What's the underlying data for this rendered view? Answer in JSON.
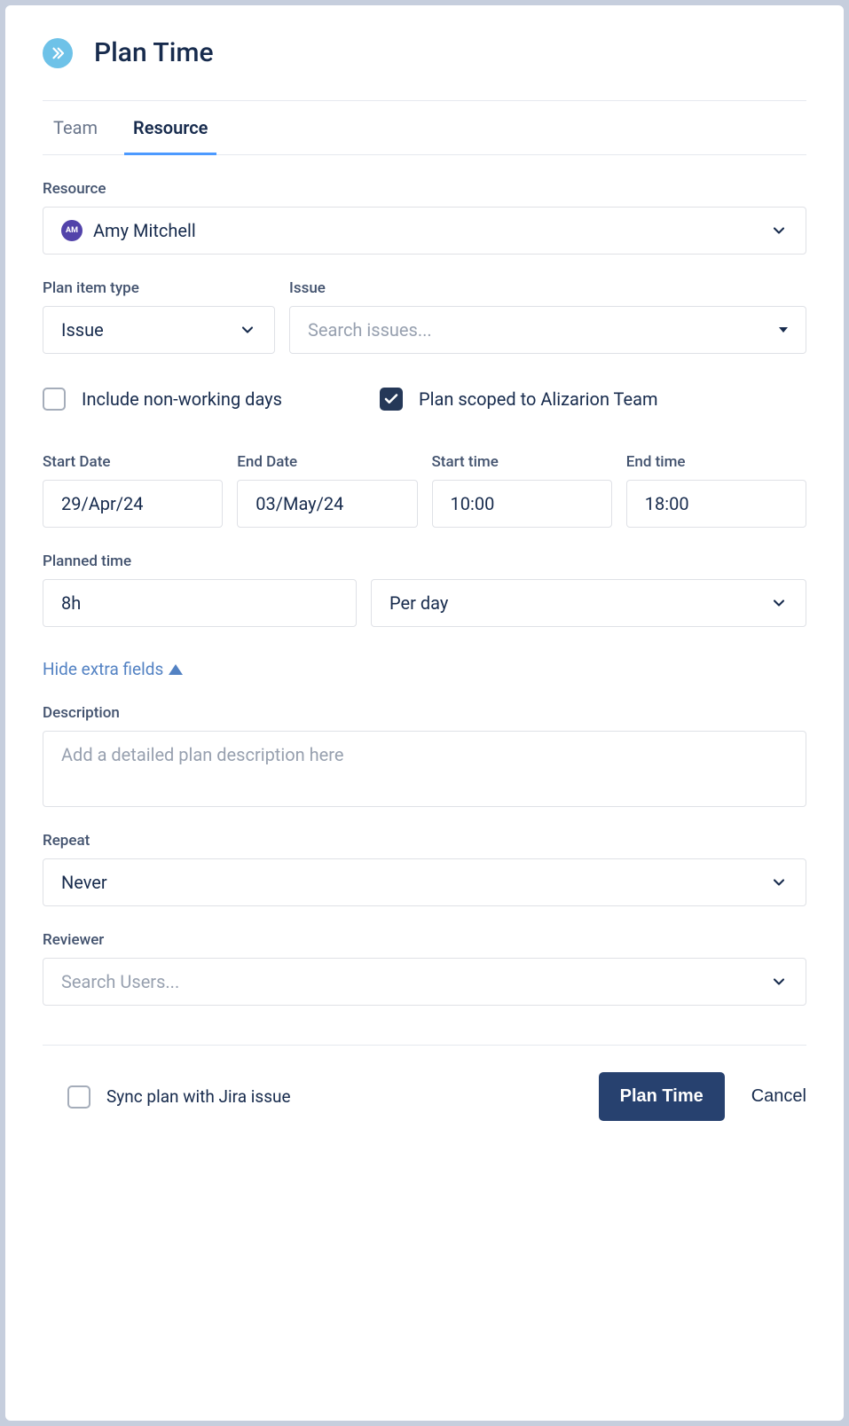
{
  "header": {
    "title": "Plan Time"
  },
  "tabs": {
    "team": "Team",
    "resource": "Resource"
  },
  "resource": {
    "label": "Resource",
    "avatar_initials": "AM",
    "value": "Amy Mitchell"
  },
  "plan_item_type": {
    "label": "Plan item type",
    "value": "Issue"
  },
  "issue": {
    "label": "Issue",
    "placeholder": "Search issues..."
  },
  "include_nonworking": {
    "label": "Include non-working days",
    "checked": false
  },
  "plan_scoped": {
    "label": "Plan scoped to Alizarion Team",
    "checked": true
  },
  "start_date": {
    "label": "Start Date",
    "value": "29/Apr/24"
  },
  "end_date": {
    "label": "End Date",
    "value": "03/May/24"
  },
  "start_time": {
    "label": "Start time",
    "value": "10:00"
  },
  "end_time": {
    "label": "End time",
    "value": "18:00"
  },
  "planned_time": {
    "label": "Planned time",
    "value": "8h"
  },
  "period": {
    "value": "Per day"
  },
  "toggle": {
    "label": "Hide extra fields"
  },
  "description": {
    "label": "Description",
    "placeholder": "Add a detailed plan description here"
  },
  "repeat": {
    "label": "Repeat",
    "value": "Never"
  },
  "reviewer": {
    "label": "Reviewer",
    "placeholder": "Search Users..."
  },
  "sync": {
    "label": "Sync plan with Jira issue",
    "checked": false
  },
  "buttons": {
    "primary": "Plan Time",
    "cancel": "Cancel"
  }
}
